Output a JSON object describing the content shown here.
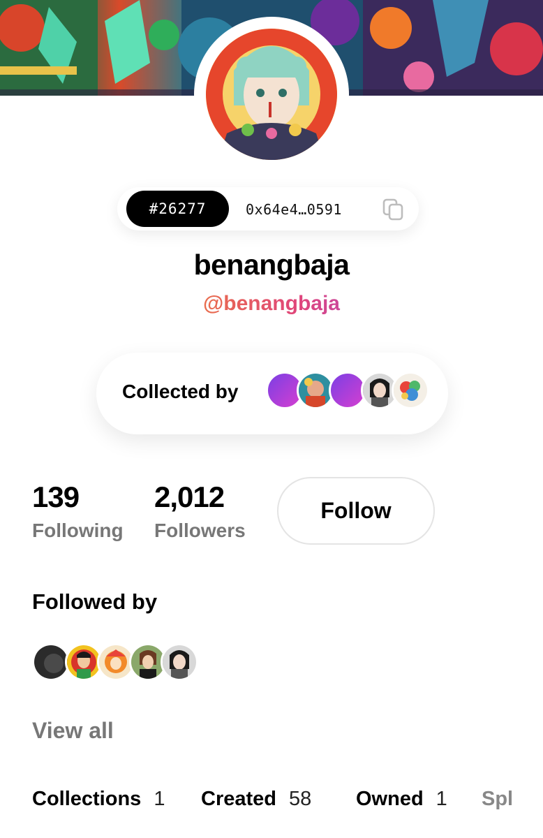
{
  "profile": {
    "token_id": "#26277",
    "address": "0x64e4…0591",
    "display_name": "benangbaja",
    "handle": "@benangbaja"
  },
  "collected_by": {
    "label": "Collected by"
  },
  "stats": {
    "following_count": "139",
    "following_label": "Following",
    "followers_count": "2,012",
    "followers_label": "Followers"
  },
  "follow_button": {
    "label": "Follow"
  },
  "followed_by": {
    "title": "Followed by",
    "view_all": "View all"
  },
  "tabs": [
    {
      "label": "Collections",
      "count": "1"
    },
    {
      "label": "Created",
      "count": "58"
    },
    {
      "label": "Owned",
      "count": "1"
    },
    {
      "label": "Spl",
      "count": ""
    }
  ],
  "colors": {
    "accent_black": "#000000",
    "muted_text": "#777777",
    "handle_gradient": [
      "#f2b61e",
      "#e0457b",
      "#a34cd6",
      "#2f9fe8"
    ],
    "purple_avatar": [
      "#7b3fe4",
      "#d63fd0"
    ]
  },
  "icons": {
    "copy": "copy-icon"
  }
}
